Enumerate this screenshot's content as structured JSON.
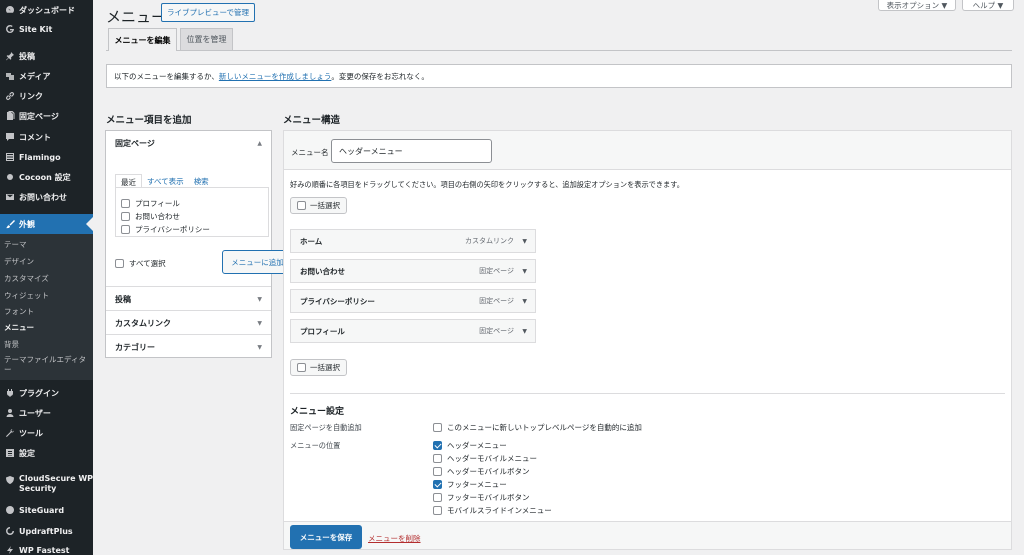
{
  "sidebar": {
    "items": [
      {
        "label": "ダッシュボード",
        "icon": "dashboard-icon"
      },
      {
        "label": "Site Kit",
        "icon": "google-g-icon"
      },
      {
        "label": "投稿",
        "icon": "pushpin-icon"
      },
      {
        "label": "メディア",
        "icon": "media-icon"
      },
      {
        "label": "リンク",
        "icon": "link-icon"
      },
      {
        "label": "固定ページ",
        "icon": "page-icon"
      },
      {
        "label": "コメント",
        "icon": "comment-icon"
      },
      {
        "label": "Flamingo",
        "icon": "list-icon"
      },
      {
        "label": "Cocoon 設定",
        "icon": "circle-icon"
      },
      {
        "label": "お問い合わせ",
        "icon": "mail-icon"
      },
      {
        "label": "外観",
        "icon": "brush-icon"
      },
      {
        "label": "プラグイン",
        "icon": "plugin-icon"
      },
      {
        "label": "ユーザー",
        "icon": "user-icon"
      },
      {
        "label": "ツール",
        "icon": "wrench-icon"
      },
      {
        "label": "設定",
        "icon": "settings-icon"
      },
      {
        "label": "CloudSecure WP Security",
        "icon": "shield-icon"
      },
      {
        "label": "SiteGuard",
        "icon": "siteguard-icon"
      },
      {
        "label": "UpdraftPlus",
        "icon": "updraft-icon"
      },
      {
        "label": "WP Fastest",
        "icon": "fastest-icon"
      }
    ],
    "submenu": [
      "テーマ",
      "デザイン",
      "カスタマイズ",
      "ウィジェット",
      "フォント",
      "メニュー",
      "背景",
      "テーマファイルエディター"
    ]
  },
  "header": {
    "title": "メニュー",
    "live_preview": "ライブプレビューで管理",
    "screen_options": "表示オプション ▼",
    "help": "ヘルプ ▼"
  },
  "tabs": [
    "メニューを編集",
    "位置を管理"
  ],
  "notice": {
    "before": "以下のメニューを編集するか、",
    "link": "新しいメニューを作成しましょう",
    "after": "。変更の保存をお忘れなく。"
  },
  "add_items": {
    "title": "メニュー項目を追加",
    "pages_title": "固定ページ",
    "inner_tabs": [
      "最近",
      "すべて表示",
      "検索"
    ],
    "pages": [
      "プロフィール",
      "お問い合わせ",
      "プライバシーポリシー"
    ],
    "select_all": "すべて選択",
    "add_button": "メニューに追加",
    "sections": [
      "投稿",
      "カスタムリンク",
      "カテゴリー"
    ]
  },
  "structure": {
    "title": "メニュー構造",
    "name_label": "メニュー名",
    "name_value": "ヘッダーメニュー",
    "instructions": "好みの順番に各項目をドラッグしてください。項目の右側の矢印をクリックすると、追加設定オプションを表示できます。",
    "bulk_select": "一括選択",
    "items": [
      {
        "title": "ホーム",
        "type": "カスタムリンク"
      },
      {
        "title": "お問い合わせ",
        "type": "固定ページ"
      },
      {
        "title": "プライバシーポリシー",
        "type": "固定ページ"
      },
      {
        "title": "プロフィール",
        "type": "固定ページ"
      }
    ]
  },
  "settings": {
    "title": "メニュー設定",
    "auto_add_label": "固定ページを自動追加",
    "auto_add_option": "このメニューに新しいトップレベルページを自動的に追加",
    "location_label": "メニューの位置",
    "locations": [
      {
        "label": "ヘッダーメニュー",
        "checked": true
      },
      {
        "label": "ヘッダーモバイルメニュー",
        "checked": false
      },
      {
        "label": "ヘッダーモバイルボタン",
        "checked": false
      },
      {
        "label": "フッターメニュー",
        "checked": true
      },
      {
        "label": "フッターモバイルボタン",
        "checked": false
      },
      {
        "label": "モバイルスライドインメニュー",
        "checked": false
      }
    ]
  },
  "footer": {
    "save": "メニューを保存",
    "delete": "メニューを削除"
  }
}
